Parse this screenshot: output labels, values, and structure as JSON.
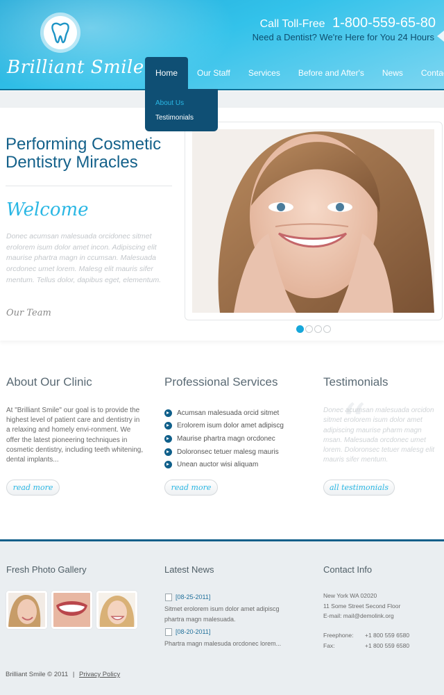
{
  "brand": {
    "name": "Brilliant Smile",
    "logo_icon": "tooth-icon"
  },
  "header": {
    "call_label": "Call Toll-Free",
    "call_number": "1-800-559-65-80",
    "tagline": "Need a Dentist? We're Here for You 24 Hours"
  },
  "nav": {
    "items": [
      {
        "label": "Home",
        "active": true
      },
      {
        "label": "Our Staff"
      },
      {
        "label": "Services"
      },
      {
        "label": "Before and After's"
      },
      {
        "label": "News"
      },
      {
        "label": "Contacts"
      }
    ],
    "dropdown": [
      "About Us",
      "Testimonials"
    ]
  },
  "hero": {
    "title_line1": "Performing Cosmetic",
    "title_line2": "Dentistry Miracles",
    "welcome": "Welcome",
    "welcome_text": "Donec acumsan malesuada orcidonec sitmet erolorem isum dolor amet incon. Adipiscing elit maurise phartra magn in ccumsan. Malesuada orcdonec umet lorem. Malesg elit mauris sifer mentum. Tellus dolor, dapibus eget, elementum.",
    "our_team": "Our Team",
    "slider_dots": 4,
    "active_dot": 1
  },
  "about": {
    "title": "About Our Clinic",
    "text": "At \"Brilliant Smile\" our goal is to provide the highest level of patient care and dentistry in a relaxing and homely envi-ronment. We offer the latest pioneering techniques in cosmetic dentistry, including teeth whitening, dental implants...",
    "button": "read more"
  },
  "services": {
    "title": "Professional Services",
    "items": [
      "Acumsan malesuada orcid sitmet",
      "Erolorem isum dolor amet adipiscg",
      "Maurise phartra magn orcdonec",
      "Doloronsec tetuer malesg mauris",
      "Unean auctor wisi aliquam"
    ],
    "button": "read more"
  },
  "testimonials": {
    "title": "Testimonials",
    "text": "Donec acumsan malesuada orcidon sitmet erolorem isum dolor amet adipiscing maurise pharm magn msan. Malesuada orcdonec umet lorem. Doloronsec tetuer malesg elit mauris sifer mentum.",
    "button": "all testimonials"
  },
  "footer": {
    "gallery_title": "Fresh Photo Gallery",
    "news_title": "Latest News",
    "news": [
      {
        "date": "[08-25-2011]",
        "text": "Sitmet erolorem isum dolor amet adipiscg phartra magn malesuada."
      },
      {
        "date": "[08-20-2011]",
        "text": "Phartra magn malesuda orcdonec lorem..."
      }
    ],
    "contact_title": "Contact Info",
    "address": [
      "New York WA 02020",
      "11 Some Street Second Floor",
      "E-mail: mail@demolink.org"
    ],
    "freephone_label": "Freephone:",
    "freephone": "+1 800 559 6580",
    "fax_label": "Fax:",
    "fax": "+1 800 559 6580",
    "copyright": "Brilliant Smile © 2011",
    "separator": "|",
    "privacy": "Privacy Policy"
  },
  "colors": {
    "accent": "#2ab7e4",
    "dark_blue": "#0f4f74",
    "title_blue": "#14618a"
  }
}
